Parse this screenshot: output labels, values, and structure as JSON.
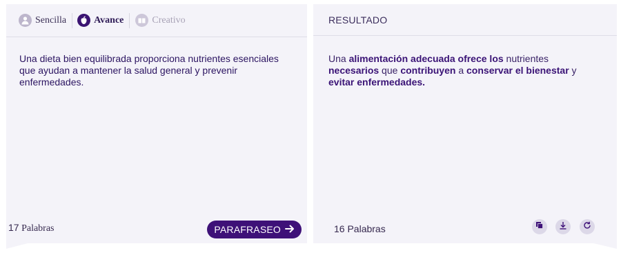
{
  "modes": [
    {
      "label": "Sencilla",
      "icon": "person-icon",
      "selected": false
    },
    {
      "label": "Avance",
      "icon": "apple-icon",
      "selected": true
    },
    {
      "label": "Creativo",
      "icon": "book-icon",
      "selected": false
    }
  ],
  "input": {
    "text": "Una dieta bien equilibrada proporciona nutrientes esenciales que ayudan a mantener la salud general y prevenir enfermedades.",
    "word_count": "17",
    "word_count_suffix": "Palabras"
  },
  "paraphrase_button": {
    "label": "PARAFRASEO",
    "icon": "arrow-right-icon"
  },
  "result": {
    "title": "RESULTADO",
    "segments": [
      {
        "text": "Una ",
        "bold": false
      },
      {
        "text": "alimentación adecuada ofrece los",
        "bold": true
      },
      {
        "text": " nutrientes ",
        "bold": false
      },
      {
        "text": "necesarios",
        "bold": true
      },
      {
        "text": " que ",
        "bold": false
      },
      {
        "text": "contribuyen",
        "bold": true
      },
      {
        "text": " a ",
        "bold": false
      },
      {
        "text": "conservar el bienestar",
        "bold": true
      },
      {
        "text": " y ",
        "bold": false
      },
      {
        "text": "evitar enfermedades.",
        "bold": true
      }
    ],
    "word_count_label": "16 Palabras"
  },
  "tools": [
    {
      "name": "copy-icon"
    },
    {
      "name": "download-icon"
    },
    {
      "name": "regenerate-icon"
    }
  ],
  "colors": {
    "accent": "#3e1178",
    "panel_bg": "#f4f3f9",
    "text": "#2b1461"
  }
}
